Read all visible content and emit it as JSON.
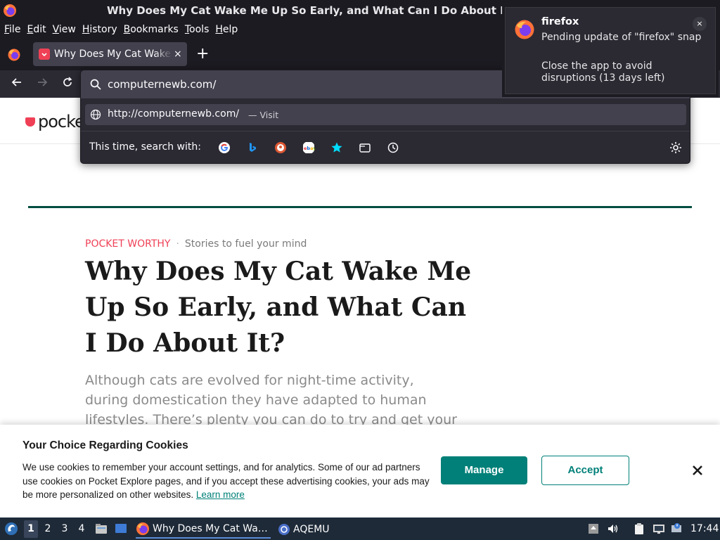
{
  "window": {
    "title": "Why Does My Cat Wake Me Up So Early, and What Can I Do About It?"
  },
  "menubar": {
    "items": [
      {
        "label": "File",
        "mnemonic": "F",
        "rest": "ile"
      },
      {
        "label": "Edit",
        "mnemonic": "E",
        "rest": "dit"
      },
      {
        "label": "View",
        "mnemonic": "V",
        "rest": "iew"
      },
      {
        "label": "History",
        "mnemonic": "H",
        "rest": "istory"
      },
      {
        "label": "Bookmarks",
        "mnemonic": "B",
        "rest": "ookmarks"
      },
      {
        "label": "Tools",
        "mnemonic": "T",
        "rest": "ools"
      },
      {
        "label": "Help",
        "mnemonic": "H",
        "rest": "elp"
      }
    ]
  },
  "tabs": [
    {
      "title": "Why Does My Cat Wake Me Up So Early",
      "favicon": "pocket-icon"
    }
  ],
  "tabstrip": {
    "close_glyph": "×",
    "new_tab_glyph": "+"
  },
  "urlbar": {
    "value": "computernewb.com/",
    "suggestion_url": "http://computernewb.com/",
    "suggestion_action": "— Visit",
    "search_with_label": "This time, search with:",
    "engines": [
      "google-icon",
      "bing-icon",
      "duckduckgo-icon",
      "ebay-icon",
      "bookmarks-icon",
      "tabs-icon",
      "history-icon"
    ]
  },
  "notification": {
    "app": "firefox",
    "line1": "Pending update of \"firefox\" snap",
    "line2": "Close the app to avoid disruptions (13 days left)",
    "close_glyph": "×"
  },
  "page": {
    "logo_text": "pocket",
    "eyebrow_brand": "POCKET WORTHY",
    "eyebrow_sep": "·",
    "eyebrow_tag": "Stories to fuel your mind",
    "headline": "Why Does My Cat Wake Me Up So Early, and What Can I Do About It?",
    "excerpt": "Although cats are evolved for night-time activity, during domestication they have adapted to human lifestyles. There’s plenty you can do to try and get your cat to stop"
  },
  "cookie_banner": {
    "title": "Your Choice Regarding Cookies",
    "text": "We use cookies to remember your account settings, and for analytics. Some of our ad partners use cookies on Pocket Explore pages, and if you accept these advertising cookies, your ads may be more personalized on other websites. ",
    "learn_more": "Learn more",
    "manage_label": "Manage",
    "accept_label": "Accept"
  },
  "taskbar": {
    "workspaces": [
      "1",
      "2",
      "3",
      "4"
    ],
    "active_workspace": "1",
    "tasks": [
      {
        "label": "Why Does My Cat Wa…",
        "icon": "firefox-icon",
        "active": true
      },
      {
        "label": "AQEMU",
        "icon": "aqemu-icon",
        "active": false
      }
    ],
    "clock": "17:44"
  },
  "colors": {
    "chrome_dark": "#1c1b22",
    "pocket_red": "#ef4056",
    "teal": "#008078",
    "rule_green": "#004d40",
    "taskbar": "#1e2a38"
  }
}
